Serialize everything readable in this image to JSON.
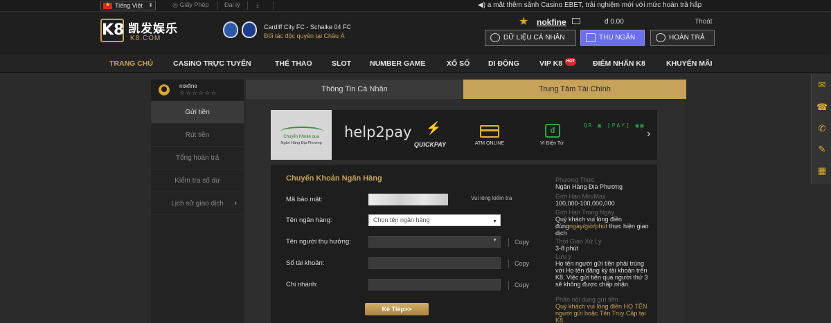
{
  "topbar": {
    "language": "Tiếng Việt",
    "license_label": "Giấy Phép",
    "agent_label": "Đại lý",
    "ticker": "a mắt thêm sảnh Casino EBET, trải nghiệm mới với mức hoàn trả hấp"
  },
  "header": {
    "logo_cn": "凯发娱乐",
    "logo_domain": "K8.COM",
    "logo_mark": "K8",
    "partner_title": "Cardiff City FC - Schalke 04 FC",
    "partner_subtitle": "Đối tác độc quyền tại Châu Á",
    "username": "nokfine",
    "balance": "đ 0.00",
    "logout": "Thoát",
    "btn_profile": "DỮ LIỆU CÁ NHÂN",
    "btn_cashier": "THU NGÂN",
    "btn_rebate": "HOÀN TRẢ"
  },
  "nav": {
    "items": [
      "TRANG CHỦ",
      "CASINO TRỰC TUYẾN",
      "THỂ THAO",
      "SLOT",
      "NUMBER GAME",
      "XỔ SỐ",
      "DI ĐỘNG",
      "VIP K8",
      "ĐIỂM NHẤN K8",
      "KHUYẾN MÃI"
    ],
    "hot_badge": "HOT"
  },
  "sidebar": {
    "username": "nokfine",
    "stars": "☆☆☆☆☆☆",
    "items": [
      "Gửi tiền",
      "Rút tiền",
      "Tổng hoàn trả",
      "Kiểm tra số dư",
      "Lịch sử giao dịch"
    ]
  },
  "tabs": {
    "personal": "Thông Tin Cá Nhân",
    "finance": "Trung Tâm Tài Chính"
  },
  "methods": {
    "bank_line1": "Chuyển Khoản qua",
    "bank_line2": "Ngân Hàng Địa Phương",
    "help2pay": "help2pay",
    "quickpay": "QUICKPAY",
    "atm": "ATM ONLINE",
    "wallet": "Ví Điện Tử",
    "qr": "QR ▣ [PAY] ▣▣"
  },
  "form": {
    "title": "Chuyển Khoản Ngân Hàng",
    "security_label": "Mã bảo mật:",
    "check_note": "Vui lòng kiểm tra",
    "bank_label": "Tên ngân hàng:",
    "bank_placeholder": "Chọn tên ngân hàng",
    "beneficiary_label": "Tên người thụ hưởng:",
    "account_label": "Số tài khoản:",
    "branch_label": "Chi nhánh:",
    "copy": "Copy",
    "next": "Kế Tiếp>>"
  },
  "info": {
    "method_h": "Phương Thức",
    "method_v": "Ngân Hàng Địa Phương",
    "limit_h": "Giới Hạn Min/Max",
    "limit_v": "100,000-100,000,000",
    "time_h": "Giới Hạn Trong Ngày",
    "time_v1": "Quý khách vui lòng điền",
    "time_v2": "đúng",
    "time_v3": "ngày/giờ/phút",
    "time_v4": " thực hiện giao dịch",
    "process_h": "Thời Gian Xử Lý",
    "process_v": "3-8 phút",
    "note_h": "Lưu ý",
    "note_v": "Họ tên người gửi tiền phải trùng với Họ tên đăng ký tài khoản trên K8. Việc gửi tiền qua người thứ 3 sẽ không được chấp nhận.",
    "content_h": "Phần nội dung gửi tiền",
    "content_v": "Quý khách vui lòng điền HỌ TÊN người gửi hoặc Tên Truy Cập tại K8."
  }
}
